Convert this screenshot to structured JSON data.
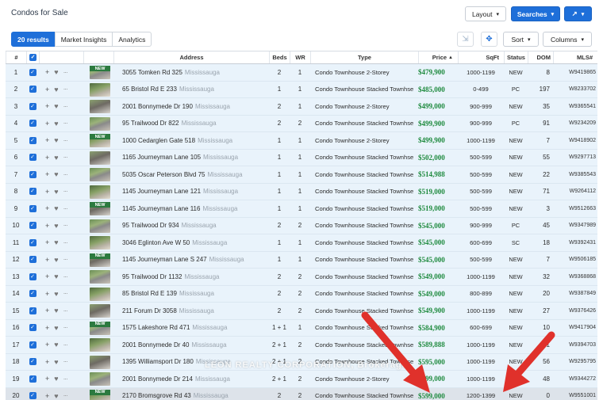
{
  "page": {
    "title": "Condos for Sale"
  },
  "toolbar": {
    "layout_label": "Layout",
    "searches_label": "Searches",
    "share_icon": "share-arrow-icon",
    "sort_label": "Sort",
    "columns_label": "Columns"
  },
  "tabs": [
    "20 results",
    "Market Insights",
    "Analytics"
  ],
  "columns": [
    "#",
    "",
    "Address",
    "Beds",
    "WR",
    "Type",
    "Price",
    "SqFt",
    "Status",
    "DOM",
    "MLS#"
  ],
  "colors": {
    "accent": "#1e6fd9",
    "price": "#1e8a3e",
    "row_bg": "#e9f3fb",
    "new_badge": "#2c7a3f",
    "arrow": "#e0312b"
  },
  "badge_text": "NEW",
  "rows": [
    {
      "num": "1",
      "new": true,
      "address": "3055 Tomken Rd 325",
      "city": "Mississauga",
      "beds": "2",
      "wr": "1",
      "type": "Condo Townhouse 2-Storey",
      "price": "$479,900",
      "sqft": "1000-1199",
      "status": "NEW",
      "dom": "8",
      "mls": "W9419865"
    },
    {
      "num": "2",
      "new": false,
      "address": "65 Bristol Rd E 233",
      "city": "Mississauga",
      "beds": "1",
      "wr": "1",
      "type": "Condo Townhouse Stacked Townhse",
      "price": "$485,000",
      "sqft": "0-499",
      "status": "PC",
      "dom": "197",
      "mls": "W8233702"
    },
    {
      "num": "3",
      "new": false,
      "address": "2001 Bonnymede Dr 190",
      "city": "Mississauga",
      "beds": "2",
      "wr": "1",
      "type": "Condo Townhouse 2-Storey",
      "price": "$499,000",
      "sqft": "900-999",
      "status": "NEW",
      "dom": "35",
      "mls": "W9365541"
    },
    {
      "num": "4",
      "new": false,
      "address": "95 Trailwood Dr 822",
      "city": "Mississauga",
      "beds": "2",
      "wr": "2",
      "type": "Condo Townhouse Stacked Townhse",
      "price": "$499,900",
      "sqft": "900-999",
      "status": "PC",
      "dom": "91",
      "mls": "W9234209"
    },
    {
      "num": "5",
      "new": true,
      "address": "1000 Cedarglen Gate 518",
      "city": "Mississauga",
      "beds": "1",
      "wr": "1",
      "type": "Condo Townhouse 2-Storey",
      "price": "$499,900",
      "sqft": "1000-1199",
      "status": "NEW",
      "dom": "7",
      "mls": "W9418902"
    },
    {
      "num": "6",
      "new": false,
      "address": "1165 Journeyman Lane 105",
      "city": "Mississauga",
      "beds": "1",
      "wr": "1",
      "type": "Condo Townhouse Stacked Townhse",
      "price": "$502,000",
      "sqft": "500-599",
      "status": "NEW",
      "dom": "55",
      "mls": "W9297713"
    },
    {
      "num": "7",
      "new": false,
      "address": "5035 Oscar Peterson Blvd 75",
      "city": "Mississauga",
      "beds": "1",
      "wr": "1",
      "type": "Condo Townhouse Stacked Townhse",
      "price": "$514,988",
      "sqft": "500-599",
      "status": "NEW",
      "dom": "22",
      "mls": "W9385543"
    },
    {
      "num": "8",
      "new": false,
      "address": "1145 Journeyman Lane 121",
      "city": "Mississauga",
      "beds": "1",
      "wr": "1",
      "type": "Condo Townhouse Stacked Townhse",
      "price": "$519,000",
      "sqft": "500-599",
      "status": "NEW",
      "dom": "71",
      "mls": "W9264112"
    },
    {
      "num": "9",
      "new": true,
      "address": "1145 Journeyman Lane 116",
      "city": "Mississauga",
      "beds": "1",
      "wr": "1",
      "type": "Condo Townhouse Stacked Townhse",
      "price": "$519,000",
      "sqft": "500-599",
      "status": "NEW",
      "dom": "3",
      "mls": "W9512663"
    },
    {
      "num": "10",
      "new": false,
      "address": "95 Trailwood Dr 934",
      "city": "Mississauga",
      "beds": "2",
      "wr": "2",
      "type": "Condo Townhouse Stacked Townhse",
      "price": "$545,000",
      "sqft": "900-999",
      "status": "PC",
      "dom": "45",
      "mls": "W9347989"
    },
    {
      "num": "11",
      "new": false,
      "address": "3046 Eglinton Ave W 50",
      "city": "Mississauga",
      "beds": "1",
      "wr": "1",
      "type": "Condo Townhouse Stacked Townhse",
      "price": "$545,000",
      "sqft": "600-699",
      "status": "SC",
      "dom": "18",
      "mls": "W9392431"
    },
    {
      "num": "12",
      "new": true,
      "address": "1145 Journeyman Lane S 247",
      "city": "Mississauga",
      "beds": "1",
      "wr": "1",
      "type": "Condo Townhouse Stacked Townhse",
      "price": "$545,000",
      "sqft": "500-599",
      "status": "NEW",
      "dom": "7",
      "mls": "W9506185"
    },
    {
      "num": "13",
      "new": false,
      "address": "95 Trailwood Dr 1132",
      "city": "Mississauga",
      "beds": "2",
      "wr": "2",
      "type": "Condo Townhouse Stacked Townhse",
      "price": "$549,000",
      "sqft": "1000-1199",
      "status": "NEW",
      "dom": "32",
      "mls": "W9368868"
    },
    {
      "num": "14",
      "new": false,
      "address": "85 Bristol Rd E 139",
      "city": "Mississauga",
      "beds": "2",
      "wr": "2",
      "type": "Condo Townhouse Stacked Townhse",
      "price": "$549,000",
      "sqft": "800-899",
      "status": "NEW",
      "dom": "20",
      "mls": "W9387849"
    },
    {
      "num": "15",
      "new": false,
      "address": "211 Forum Dr 3058",
      "city": "Mississauga",
      "beds": "2",
      "wr": "2",
      "type": "Condo Townhouse Stacked Townhse",
      "price": "$549,900",
      "sqft": "1000-1199",
      "status": "NEW",
      "dom": "27",
      "mls": "W9376426"
    },
    {
      "num": "16",
      "new": true,
      "address": "1575 Lakeshore Rd 471",
      "city": "Mississauga",
      "beds": "1 + 1",
      "wr": "1",
      "type": "Condo Townhouse Stacked Townhse",
      "price": "$584,900",
      "sqft": "600-699",
      "status": "NEW",
      "dom": "10",
      "mls": "W9417904"
    },
    {
      "num": "17",
      "new": false,
      "address": "2001 Bonnymede Dr 40",
      "city": "Mississauga",
      "beds": "2 + 1",
      "wr": "2",
      "type": "Condo Townhouse Stacked Townhse",
      "price": "$589,888",
      "sqft": "1000-1199",
      "status": "NEW",
      "dom": "41",
      "mls": "W9394703"
    },
    {
      "num": "18",
      "new": false,
      "address": "1395 Williamsport Dr 180",
      "city": "Mississauga",
      "beds": "2 + 1",
      "wr": "2",
      "type": "Condo Townhouse Stacked Townhse",
      "price": "$595,000",
      "sqft": "1000-1199",
      "status": "NEW",
      "dom": "56",
      "mls": "W9295795"
    },
    {
      "num": "19",
      "new": false,
      "address": "2001 Bonnymede Dr 214",
      "city": "Mississauga",
      "beds": "2 + 1",
      "wr": "2",
      "type": "Condo Townhouse 2-Storey",
      "price": "$599,000",
      "sqft": "1000-1199",
      "status": "NEW",
      "dom": "48",
      "mls": "W9344272"
    },
    {
      "num": "20",
      "new": true,
      "address": "2170 Bromsgrove Rd 43",
      "city": "Mississauga",
      "beds": "2",
      "wr": "2",
      "type": "Condo Townhouse Stacked Townhse",
      "price": "$599,000",
      "sqft": "1200-1399",
      "status": "NEW",
      "dom": "0",
      "mls": "W9551001"
    }
  ],
  "watermark": "LEON REALTY CORPORATION, Brokerage"
}
